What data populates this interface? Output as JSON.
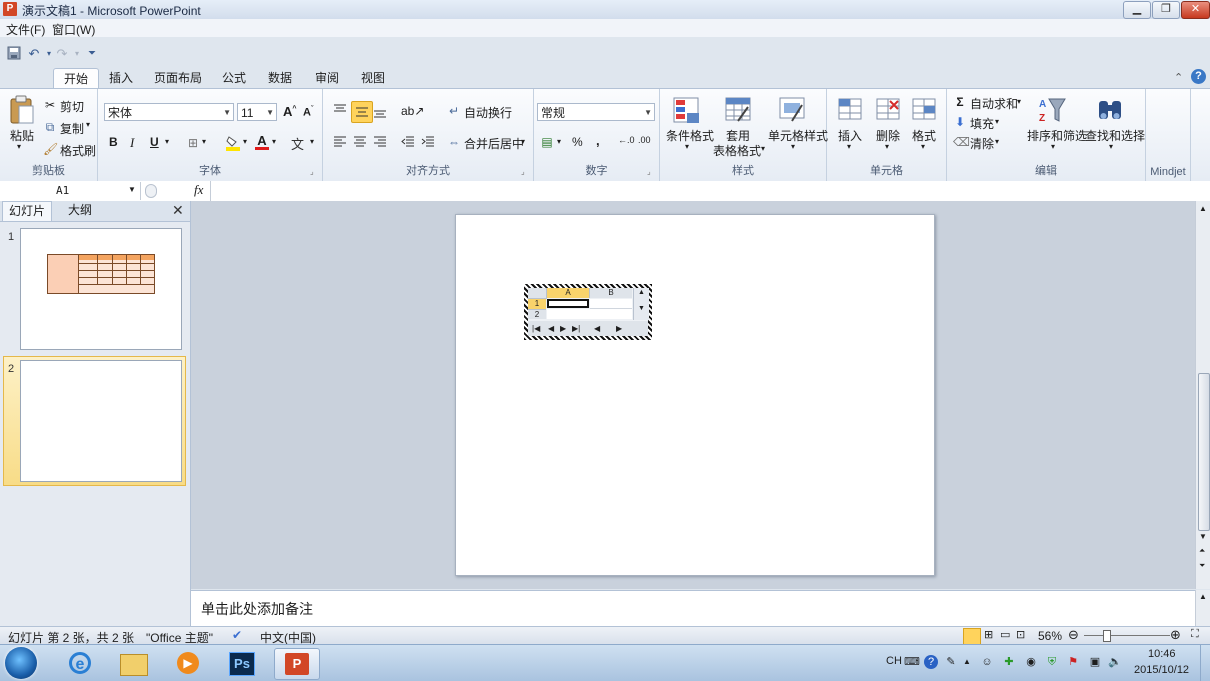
{
  "window": {
    "title": "演示文稿1 - Microsoft PowerPoint",
    "app_badge": "P"
  },
  "menu": {
    "file": "文件(F)",
    "window": "窗口(W)"
  },
  "tabs": [
    "开始",
    "插入",
    "页面布局",
    "公式",
    "数据",
    "审阅",
    "视图"
  ],
  "ribbon": {
    "clipboard": {
      "group": "剪贴板",
      "paste": "粘贴",
      "cut": "剪切",
      "copy": "复制",
      "format_painter": "格式刷"
    },
    "font": {
      "group": "字体",
      "name": "宋体",
      "size": "11",
      "bold": "B",
      "italic": "I",
      "underline": "U"
    },
    "alignment": {
      "group": "对齐方式",
      "wrap": "自动换行",
      "merge": "合并后居中"
    },
    "number": {
      "group": "数字",
      "format": "常规",
      "percent": "%",
      "comma": ","
    },
    "styles": {
      "group": "样式",
      "conditional": "条件格式",
      "table_fmt_1": "套用",
      "table_fmt_2": "表格格式",
      "cell_styles": "单元格样式"
    },
    "cells": {
      "group": "单元格",
      "insert": "插入",
      "delete": "删除",
      "format": "格式"
    },
    "editing": {
      "group": "编辑",
      "autosum": "自动求和",
      "fill": "填充",
      "clear": "清除",
      "sort_filter": "排序和筛选",
      "find_select": "查找和选择"
    },
    "mindjet": {
      "group": "Mindjet"
    }
  },
  "formula_bar": {
    "name_box": "A1",
    "fx": "fx"
  },
  "left_pane": {
    "tab_slides": "幻灯片",
    "tab_outline": "大纲",
    "slide_numbers": [
      "1",
      "2"
    ]
  },
  "embedded_sheet": {
    "col_a": "A",
    "col_b": "B",
    "row_1": "1",
    "row_2": "2"
  },
  "notes": {
    "placeholder": "单击此处添加备注"
  },
  "status": {
    "slide_info": "幻灯片 第 2 张，共 2 张",
    "theme": "\"Office 主题\"",
    "language": "中文(中国)",
    "zoom": "56%"
  },
  "taskbar": {
    "ime": "CH",
    "time": "10:46",
    "date": "2015/10/12",
    "ps_label": "Ps"
  }
}
